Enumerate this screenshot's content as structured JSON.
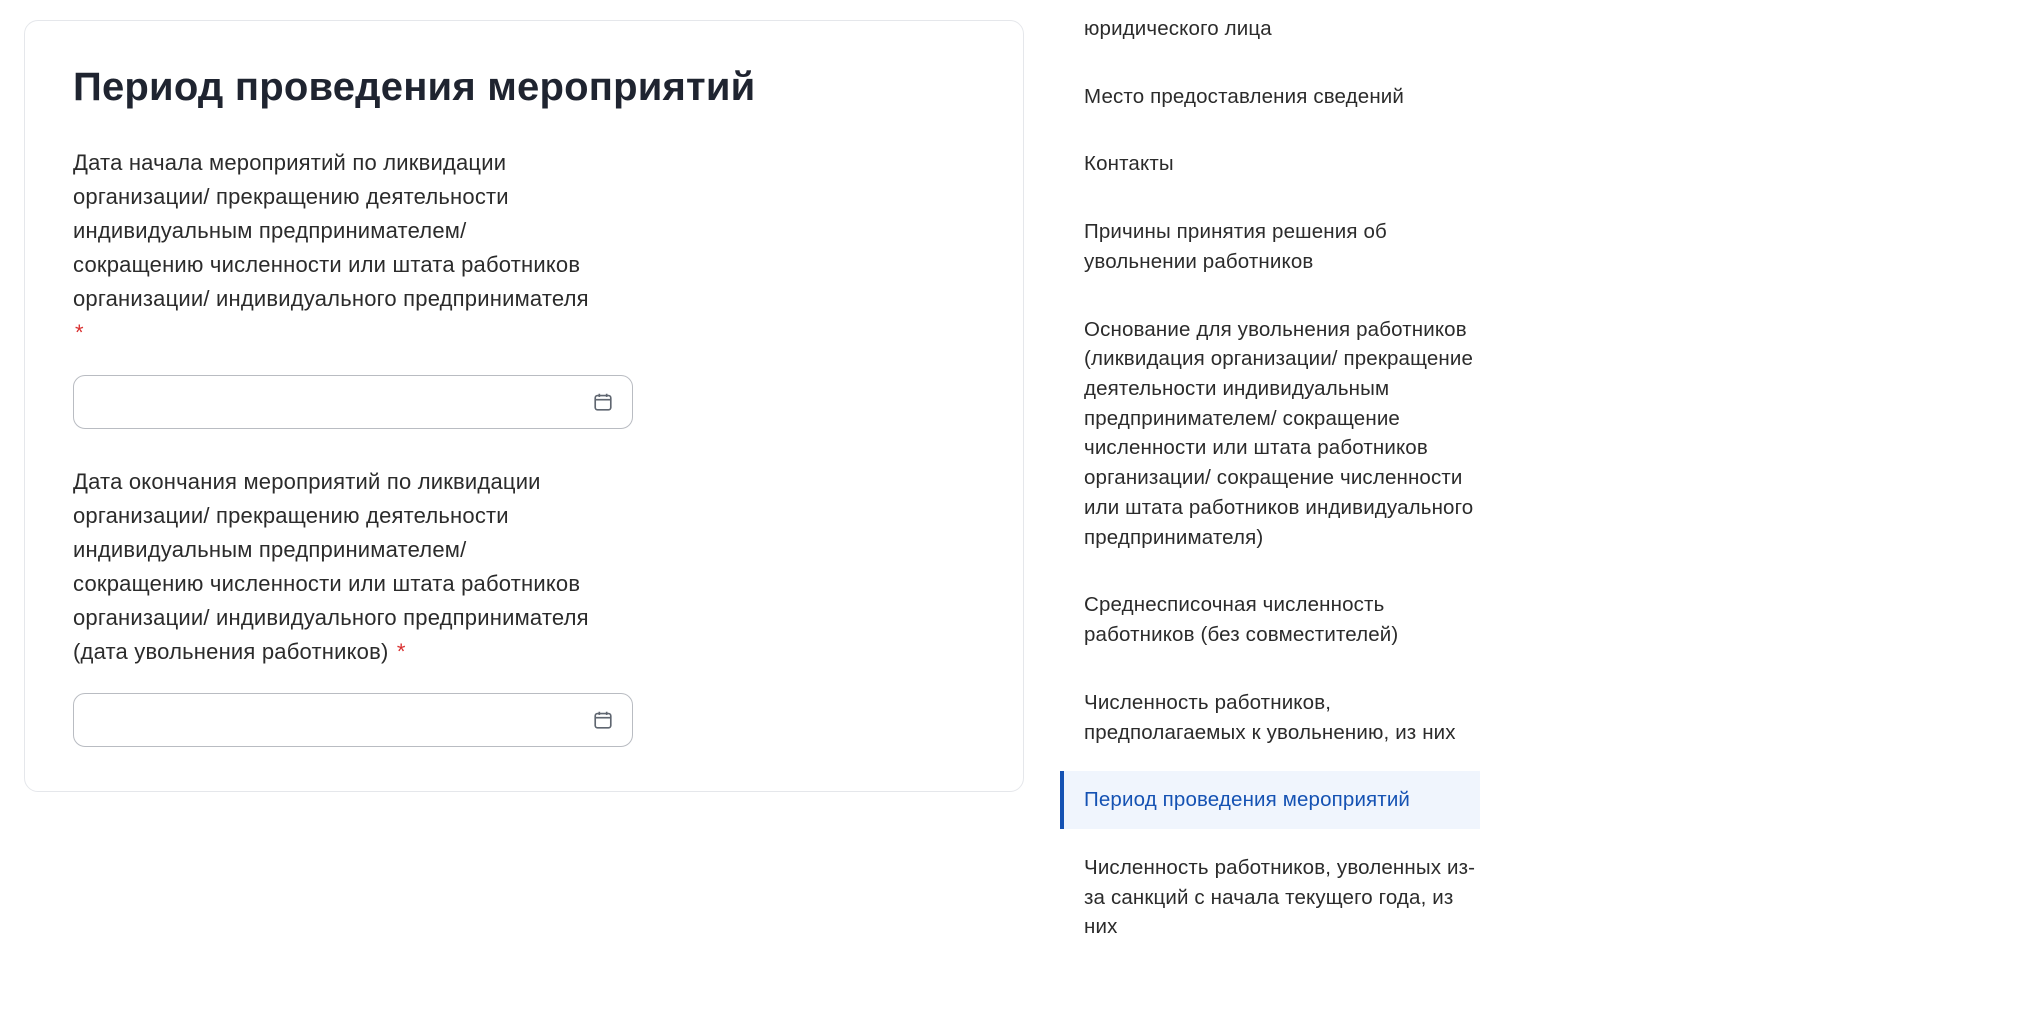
{
  "form": {
    "title": "Период проведения мероприятий",
    "fields": [
      {
        "label": "Дата начала мероприятий по ликвидации организации/ прекращению деятельности индивидуальным предпринимателем/ сокращению численности или штата работников организации/ индивидуального предпринимателя",
        "required": true,
        "value": ""
      },
      {
        "label": "Дата окончания мероприятий по ликвидации организации/ прекращению деятельности индивидуальным предпринимателем/ сокращению численности или штата работников организации/ индивидуального предпринимателя (дата увольнения работников)",
        "required": true,
        "value": ""
      }
    ]
  },
  "nav": {
    "items": [
      {
        "label": "юридического лица",
        "active": false
      },
      {
        "label": "Место предоставления сведений",
        "active": false
      },
      {
        "label": "Контакты",
        "active": false
      },
      {
        "label": "Причины принятия решения об увольнении работников",
        "active": false
      },
      {
        "label": "Основание для увольнения работников (ликвидация организации/ прекращение деятельности индивидуальным предпринимателем/ сокращение численности или штата работников организации/ сокращение численности или штата работников индивидуального предпринимателя)",
        "active": false
      },
      {
        "label": "Среднесписочная численность работников (без совместителей)",
        "active": false
      },
      {
        "label": "Численность работников, предполагаемых к увольнению, из них",
        "active": false
      },
      {
        "label": "Период проведения мероприятий",
        "active": true
      },
      {
        "label": "Численность работников, уволенных из-за санкций с начала текущего года, из них",
        "active": false
      }
    ]
  },
  "required_marker": "*"
}
